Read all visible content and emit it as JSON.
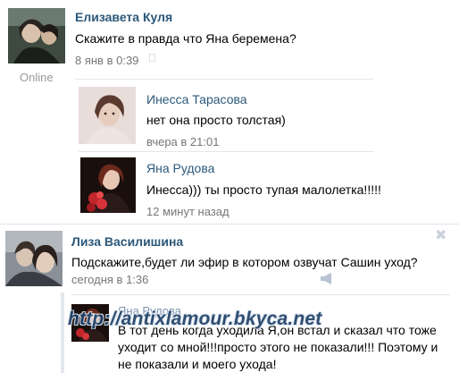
{
  "post": {
    "author": "Елизавета Куля",
    "text": "Скажите в правда что Яна беремена?",
    "time": "8 янв в 0:39",
    "status": "Online"
  },
  "replies": [
    {
      "author": "Инесса Тарасова",
      "text": "нет она просто толстая)",
      "time": "вчера в 21:01"
    },
    {
      "author": "Яна Рудова",
      "text": "Инесса))) ты просто тупая малолетка!!!!!",
      "time": "12 минут назад"
    }
  ],
  "post2": {
    "author": "Лиза Василишина",
    "text": "Подскажите,будет ли эфир в котором озвучат Сашин уход?",
    "time": "сегодня в 1:36"
  },
  "reply2": {
    "author": "Яна Рудова",
    "lines": [
      "В тот день когда уходила Я,он встал и сказал что тоже",
      "уходит со мной!!!просто этого не показали!!! Поэтому и",
      "не показали и моего ухода!"
    ]
  },
  "watermark": "http://antixlamour.bkyca.net",
  "icons": [
    "apple-icon",
    "close-icon",
    "megaphone-icon"
  ]
}
